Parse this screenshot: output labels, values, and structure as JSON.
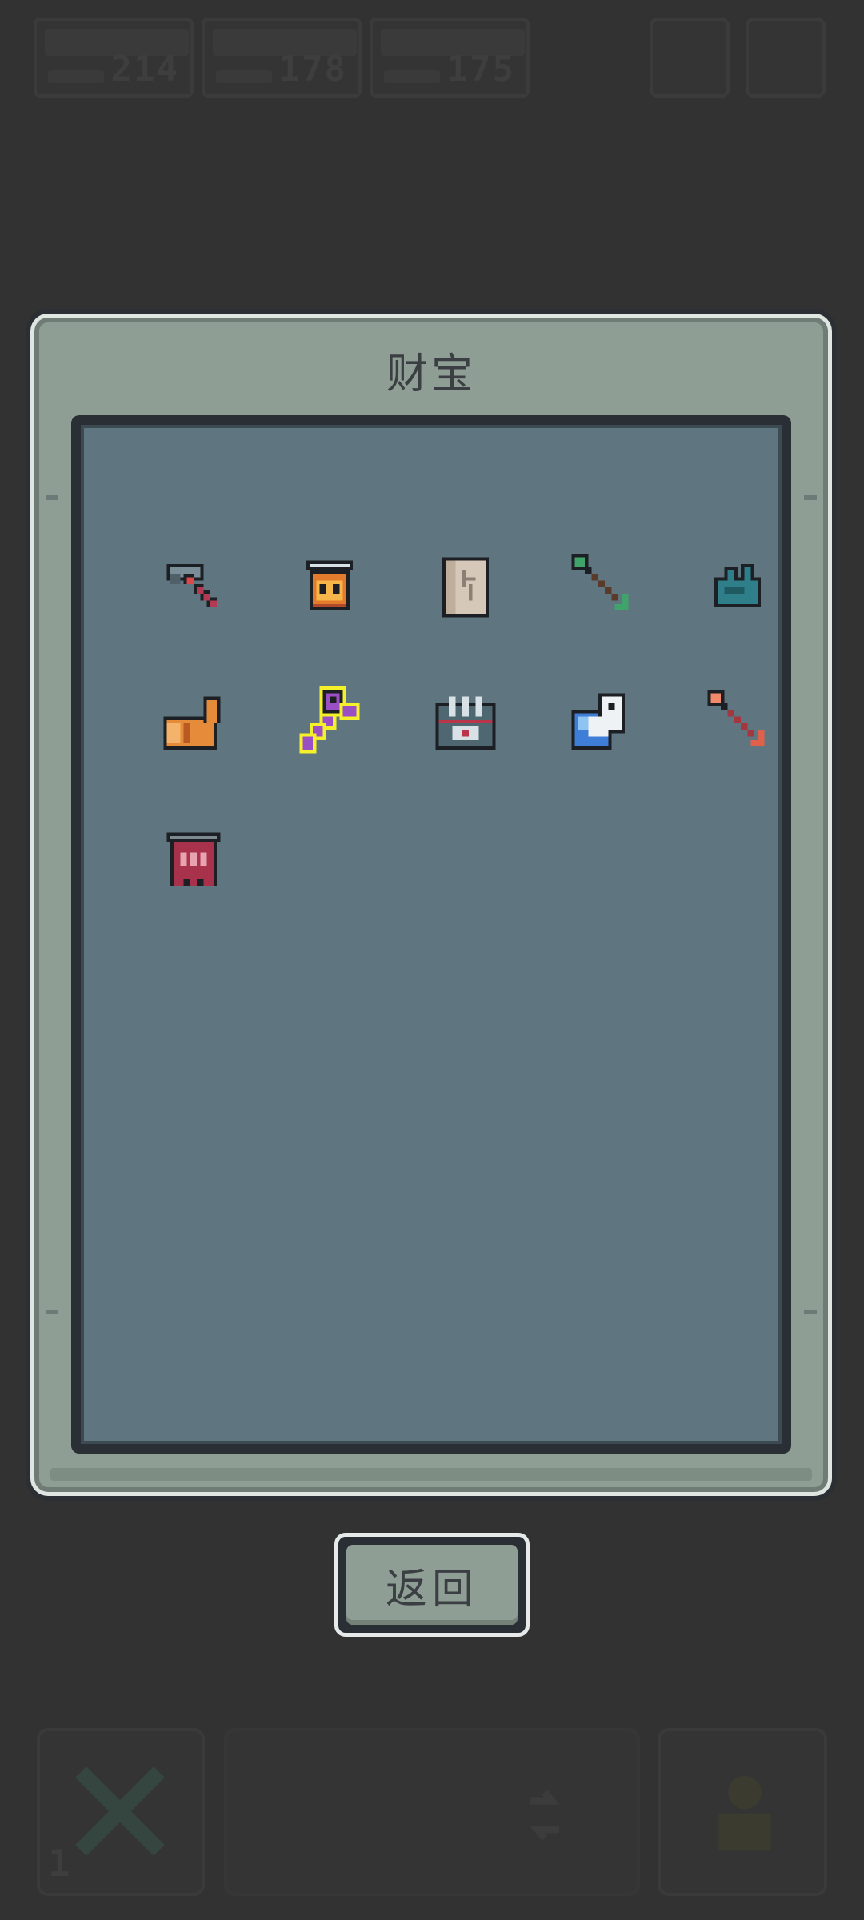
{
  "hud": {
    "stats": [
      {
        "value": "214"
      },
      {
        "value": "178"
      },
      {
        "value": "175"
      }
    ],
    "bottom_left_tag": "1"
  },
  "treasure_panel": {
    "title": "财宝",
    "items": [
      {
        "icon": "hammer-icon",
        "selected": false
      },
      {
        "icon": "lantern-icon",
        "selected": false
      },
      {
        "icon": "scroll-icon",
        "selected": false
      },
      {
        "icon": "green-arrow-icon",
        "selected": false
      },
      {
        "icon": "teal-feather-icon",
        "selected": false
      },
      {
        "icon": "horn-icon",
        "selected": false
      },
      {
        "icon": "purple-key-icon",
        "selected": true
      },
      {
        "icon": "chest-icon",
        "selected": false
      },
      {
        "icon": "ghost-orb-icon",
        "selected": false
      },
      {
        "icon": "red-arrow-icon",
        "selected": false
      },
      {
        "icon": "red-banner-icon",
        "selected": false
      }
    ]
  },
  "return_button": {
    "label": "返回"
  },
  "colors": {
    "panel": "#8f9e94",
    "inner": "#5f7680",
    "selection": "#f4f02a"
  }
}
